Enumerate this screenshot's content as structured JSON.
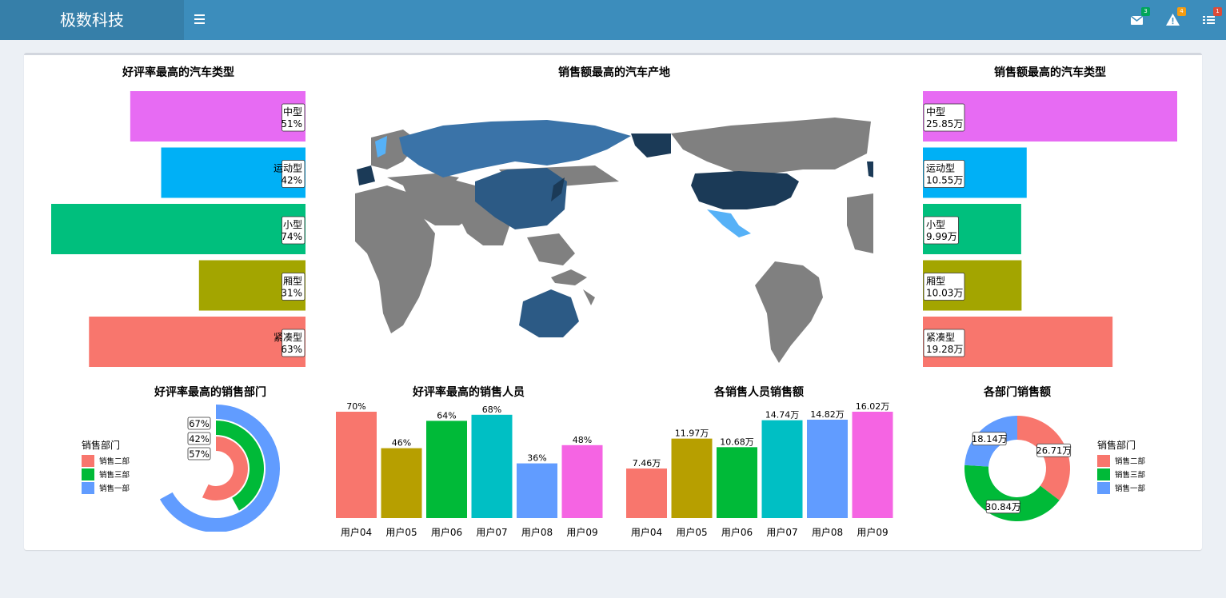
{
  "header": {
    "brand": "极数科技",
    "menu_icon": "hamburger-icon",
    "badges": [
      {
        "icon": "envelope-icon",
        "count": "3",
        "color": "#00a65a"
      },
      {
        "icon": "warning-icon",
        "count": "4",
        "color": "#f39c12"
      },
      {
        "icon": "tasks-icon",
        "count": "1",
        "color": "#dd4b39"
      }
    ]
  },
  "chart_data": [
    {
      "type": "bar",
      "orientation": "horizontal",
      "direction": "right-anchored",
      "title": "好评率最高的汽车类型",
      "categories": [
        "中型",
        "运动型",
        "小型",
        "厢型",
        "紧凑型"
      ],
      "values": [
        51,
        42,
        74,
        31,
        63
      ],
      "labels": [
        "51%",
        "42%",
        "74%",
        "31%",
        "63%"
      ],
      "colors": [
        "#e76bf3",
        "#00b0f6",
        "#00bf7d",
        "#a3a500",
        "#f8766d"
      ]
    },
    {
      "type": "map",
      "title": "销售额最高的汽车产地",
      "colors": {
        "highest": "#1b3a57",
        "high": "#2c5a85",
        "medium": "#3a73a8",
        "low": "#56b1f7",
        "none": "#808080"
      }
    },
    {
      "type": "bar",
      "orientation": "horizontal",
      "direction": "left-anchored",
      "title": "销售额最高的汽车类型",
      "categories": [
        "中型",
        "运动型",
        "小型",
        "厢型",
        "紧凑型"
      ],
      "values": [
        25.85,
        10.55,
        9.99,
        10.03,
        19.28
      ],
      "labels": [
        "25.85万",
        "10.55万",
        "9.99万",
        "10.03万",
        "19.28万"
      ],
      "colors": [
        "#e76bf3",
        "#00b0f6",
        "#00bf7d",
        "#a3a500",
        "#f8766d"
      ]
    },
    {
      "type": "radial-bar",
      "title": "好评率最高的销售部门",
      "legend_title": "销售部门",
      "legend_position": "left",
      "series": [
        {
          "name": "销售二部",
          "value": 57,
          "label": "57%",
          "color": "#f8766d"
        },
        {
          "name": "销售三部",
          "value": 42,
          "label": "42%",
          "color": "#00ba38"
        },
        {
          "name": "销售一部",
          "value": 67,
          "label": "67%",
          "color": "#619cff"
        }
      ]
    },
    {
      "type": "bar",
      "title": "好评率最高的销售人员",
      "categories": [
        "用户04",
        "用户05",
        "用户06",
        "用户07",
        "用户08",
        "用户09"
      ],
      "values": [
        70,
        46,
        64,
        68,
        36,
        48
      ],
      "labels": [
        "70%",
        "46%",
        "64%",
        "68%",
        "36%",
        "48%"
      ],
      "colors": [
        "#f8766d",
        "#b79f00",
        "#00ba38",
        "#00bfc4",
        "#619cff",
        "#f564e3"
      ]
    },
    {
      "type": "bar",
      "title": "各销售人员销售额",
      "categories": [
        "用户04",
        "用户05",
        "用户06",
        "用户07",
        "用户08",
        "用户09"
      ],
      "values": [
        7.46,
        11.97,
        10.68,
        14.74,
        14.82,
        16.02
      ],
      "labels": [
        "7.46万",
        "11.97万",
        "10.68万",
        "14.74万",
        "14.82万",
        "16.02万"
      ],
      "colors": [
        "#f8766d",
        "#b79f00",
        "#00ba38",
        "#00bfc4",
        "#619cff",
        "#f564e3"
      ]
    },
    {
      "type": "pie",
      "style": "donut",
      "title": "各部门销售额",
      "legend_title": "销售部门",
      "legend_position": "right",
      "series": [
        {
          "name": "销售二部",
          "value": 26.71,
          "label": "26.71万",
          "color": "#f8766d"
        },
        {
          "name": "销售三部",
          "value": 30.84,
          "label": "30.84万",
          "color": "#00ba38"
        },
        {
          "name": "销售一部",
          "value": 18.14,
          "label": "18.14万",
          "color": "#619cff"
        }
      ]
    }
  ]
}
